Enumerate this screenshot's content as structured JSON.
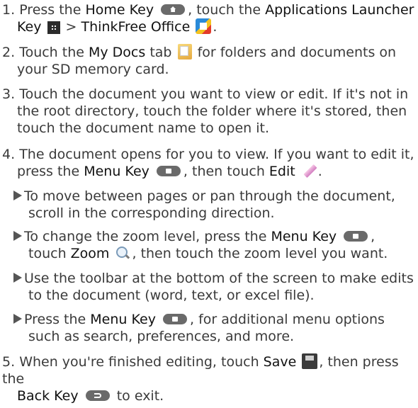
{
  "icons": {
    "home_key": "home-key",
    "apps_key": "applications-launcher-key",
    "thinkfree": "thinkfree-office",
    "mydocs": "my-docs-tab",
    "menu_key": "menu-key",
    "edit": "edit-pencil",
    "zoom": "zoom-magnifier",
    "save": "save-disk",
    "back_key": "back-key"
  },
  "steps": [
    {
      "num": "1.",
      "t1": "Press the",
      "home_key": "Home Key",
      "t2": ", touch the",
      "apps_launcher": "Applications Launcher",
      "key_word": "Key",
      "t3": ">",
      "thinkfree": "ThinkFree Office",
      "t4": "."
    },
    {
      "num": "2.",
      "t1": "Touch the",
      "mydocs": "My Docs",
      "t2": "tab",
      "t3": "for folders and documents on",
      "t4": "your SD memory card."
    },
    {
      "num": "3.",
      "l1": "Touch the document you want to view or edit.  If it's not in",
      "l2": "the root directory, touch the folder where it's stored, then",
      "l3": "touch the document name to open it."
    },
    {
      "num": "4.",
      "l1": "The document opens for you to view. If you want to edit it,",
      "t1": "press the",
      "menu_key": "Menu Key",
      "t2": ", then touch",
      "edit": "Edit",
      "t3": "."
    },
    {
      "num": "5.",
      "t1": "When you're finished editing, touch",
      "save": "Save",
      "t2": ", then press the",
      "back_key": "Back Key",
      "t3": "to exit."
    }
  ],
  "bullets": [
    {
      "l1": "To move between pages or pan through the document,",
      "l2": "scroll in the corresponding direction."
    },
    {
      "t1": "To change the zoom level, press the",
      "menu_key": "Menu Key",
      "t2": ",",
      "t3": "touch",
      "zoom": "Zoom",
      "t4": ", then touch the zoom level you want."
    },
    {
      "l1": "Use the toolbar at the bottom of the screen to make edits",
      "l2": "to the document (word, text, or excel file)."
    },
    {
      "t1": "Press the",
      "menu_key": "Menu Key",
      "t2": ", for additional menu options",
      "l2": "such as search, preferences, and more."
    }
  ]
}
